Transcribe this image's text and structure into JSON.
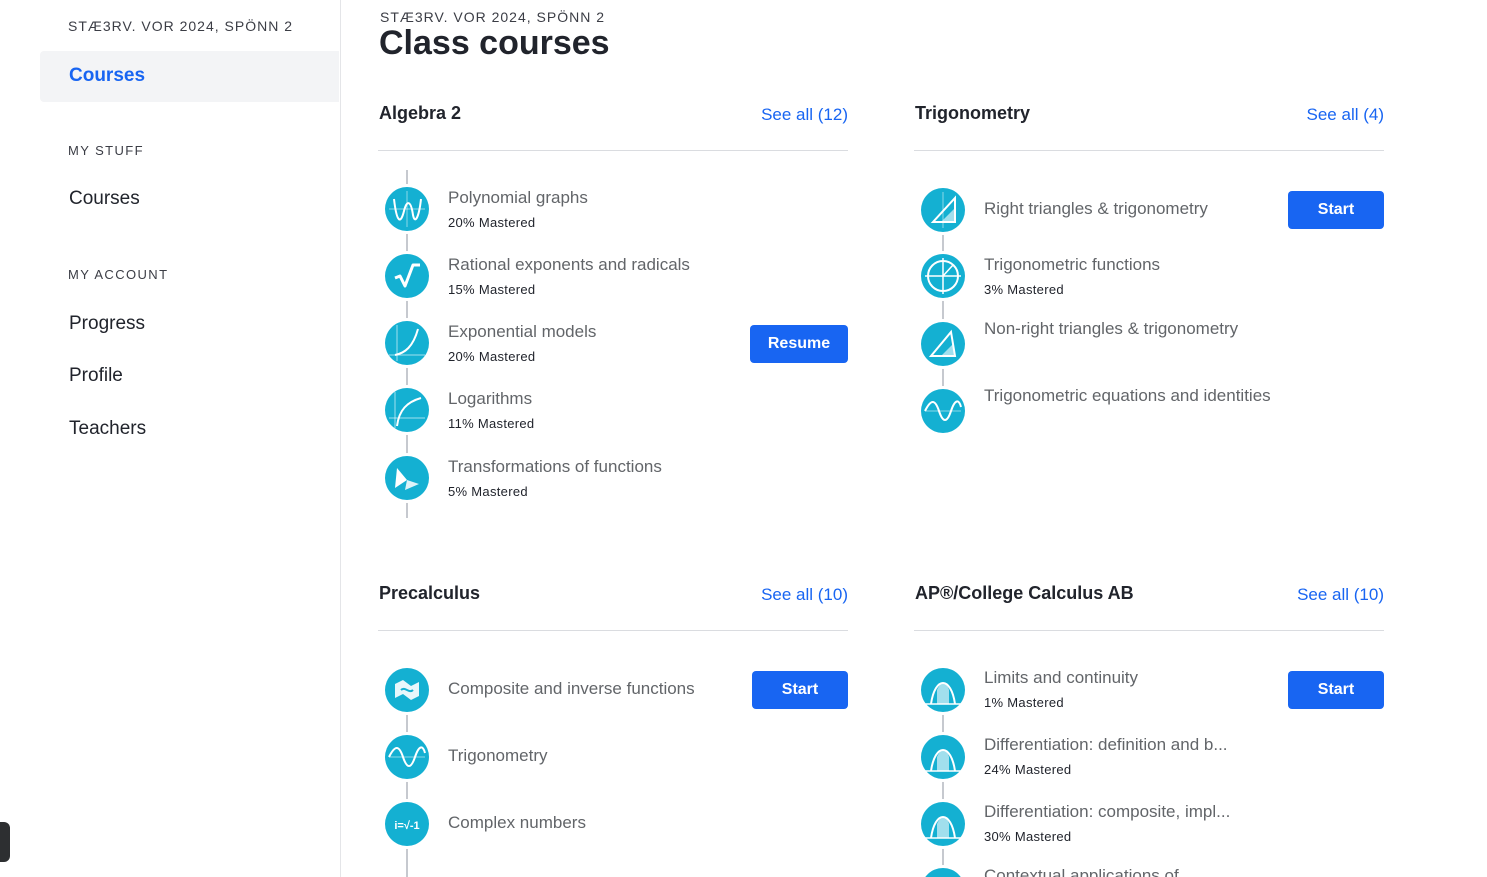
{
  "sidebar": {
    "class_name": "STÆ3RV. VOR 2024, SPÖNN 2",
    "active_item": "Courses",
    "my_stuff_heading": "MY STUFF",
    "my_stuff_items": [
      "Courses"
    ],
    "my_account_heading": "MY ACCOUNT",
    "my_account_items": [
      "Progress",
      "Profile",
      "Teachers"
    ]
  },
  "main": {
    "class_name": "STÆ3RV. VOR 2024, SPÖNN 2",
    "title": "Class courses"
  },
  "courses": [
    {
      "title": "Algebra 2",
      "see_all": "See all (12)",
      "units": [
        {
          "title": "Polynomial graphs",
          "mastery": "20% Mastered",
          "icon": "polynomial-graph-icon"
        },
        {
          "title": "Rational exponents and radicals",
          "mastery": "15% Mastered",
          "icon": "square-root-icon"
        },
        {
          "title": "Exponential models",
          "mastery": "20% Mastered",
          "icon": "exponential-curve-icon",
          "button": "Resume"
        },
        {
          "title": "Logarithms",
          "mastery": "11% Mastered",
          "icon": "logarithm-curve-icon"
        },
        {
          "title": "Transformations of functions",
          "mastery": "5% Mastered",
          "icon": "transformation-icon"
        }
      ]
    },
    {
      "title": "Trigonometry",
      "see_all": "See all (4)",
      "units": [
        {
          "title": "Right triangles & trigonometry",
          "mastery": "",
          "icon": "right-triangle-icon",
          "button": "Start"
        },
        {
          "title": "Trigonometric functions",
          "mastery": "3% Mastered",
          "icon": "unit-circle-icon"
        },
        {
          "title": "Non-right triangles & trigonometry",
          "mastery": "",
          "icon": "triangle-icon"
        },
        {
          "title": "Trigonometric equations and identities",
          "mastery": "",
          "icon": "sine-wave-icon"
        }
      ]
    },
    {
      "title": "Precalculus",
      "see_all": "See all (10)",
      "units": [
        {
          "title": "Composite and inverse functions",
          "mastery": "",
          "icon": "composite-function-icon",
          "button": "Start"
        },
        {
          "title": "Trigonometry",
          "mastery": "",
          "icon": "sine-wave-icon"
        },
        {
          "title": "Complex numbers",
          "mastery": "",
          "icon": "imaginary-unit-icon"
        }
      ]
    },
    {
      "title": "AP®/College Calculus AB",
      "see_all": "See all (10)",
      "units": [
        {
          "title": "Limits and continuity",
          "mastery": "1% Mastered",
          "icon": "area-under-curve-icon",
          "button": "Start"
        },
        {
          "title": "Differentiation: definition and b...",
          "mastery": "24% Mastered",
          "icon": "area-under-curve-icon"
        },
        {
          "title": "Differentiation: composite, impl...",
          "mastery": "30% Mastered",
          "icon": "area-under-curve-icon"
        },
        {
          "title": "Contextual applications of",
          "mastery": "",
          "icon": "area-under-curve-icon"
        }
      ]
    }
  ]
}
